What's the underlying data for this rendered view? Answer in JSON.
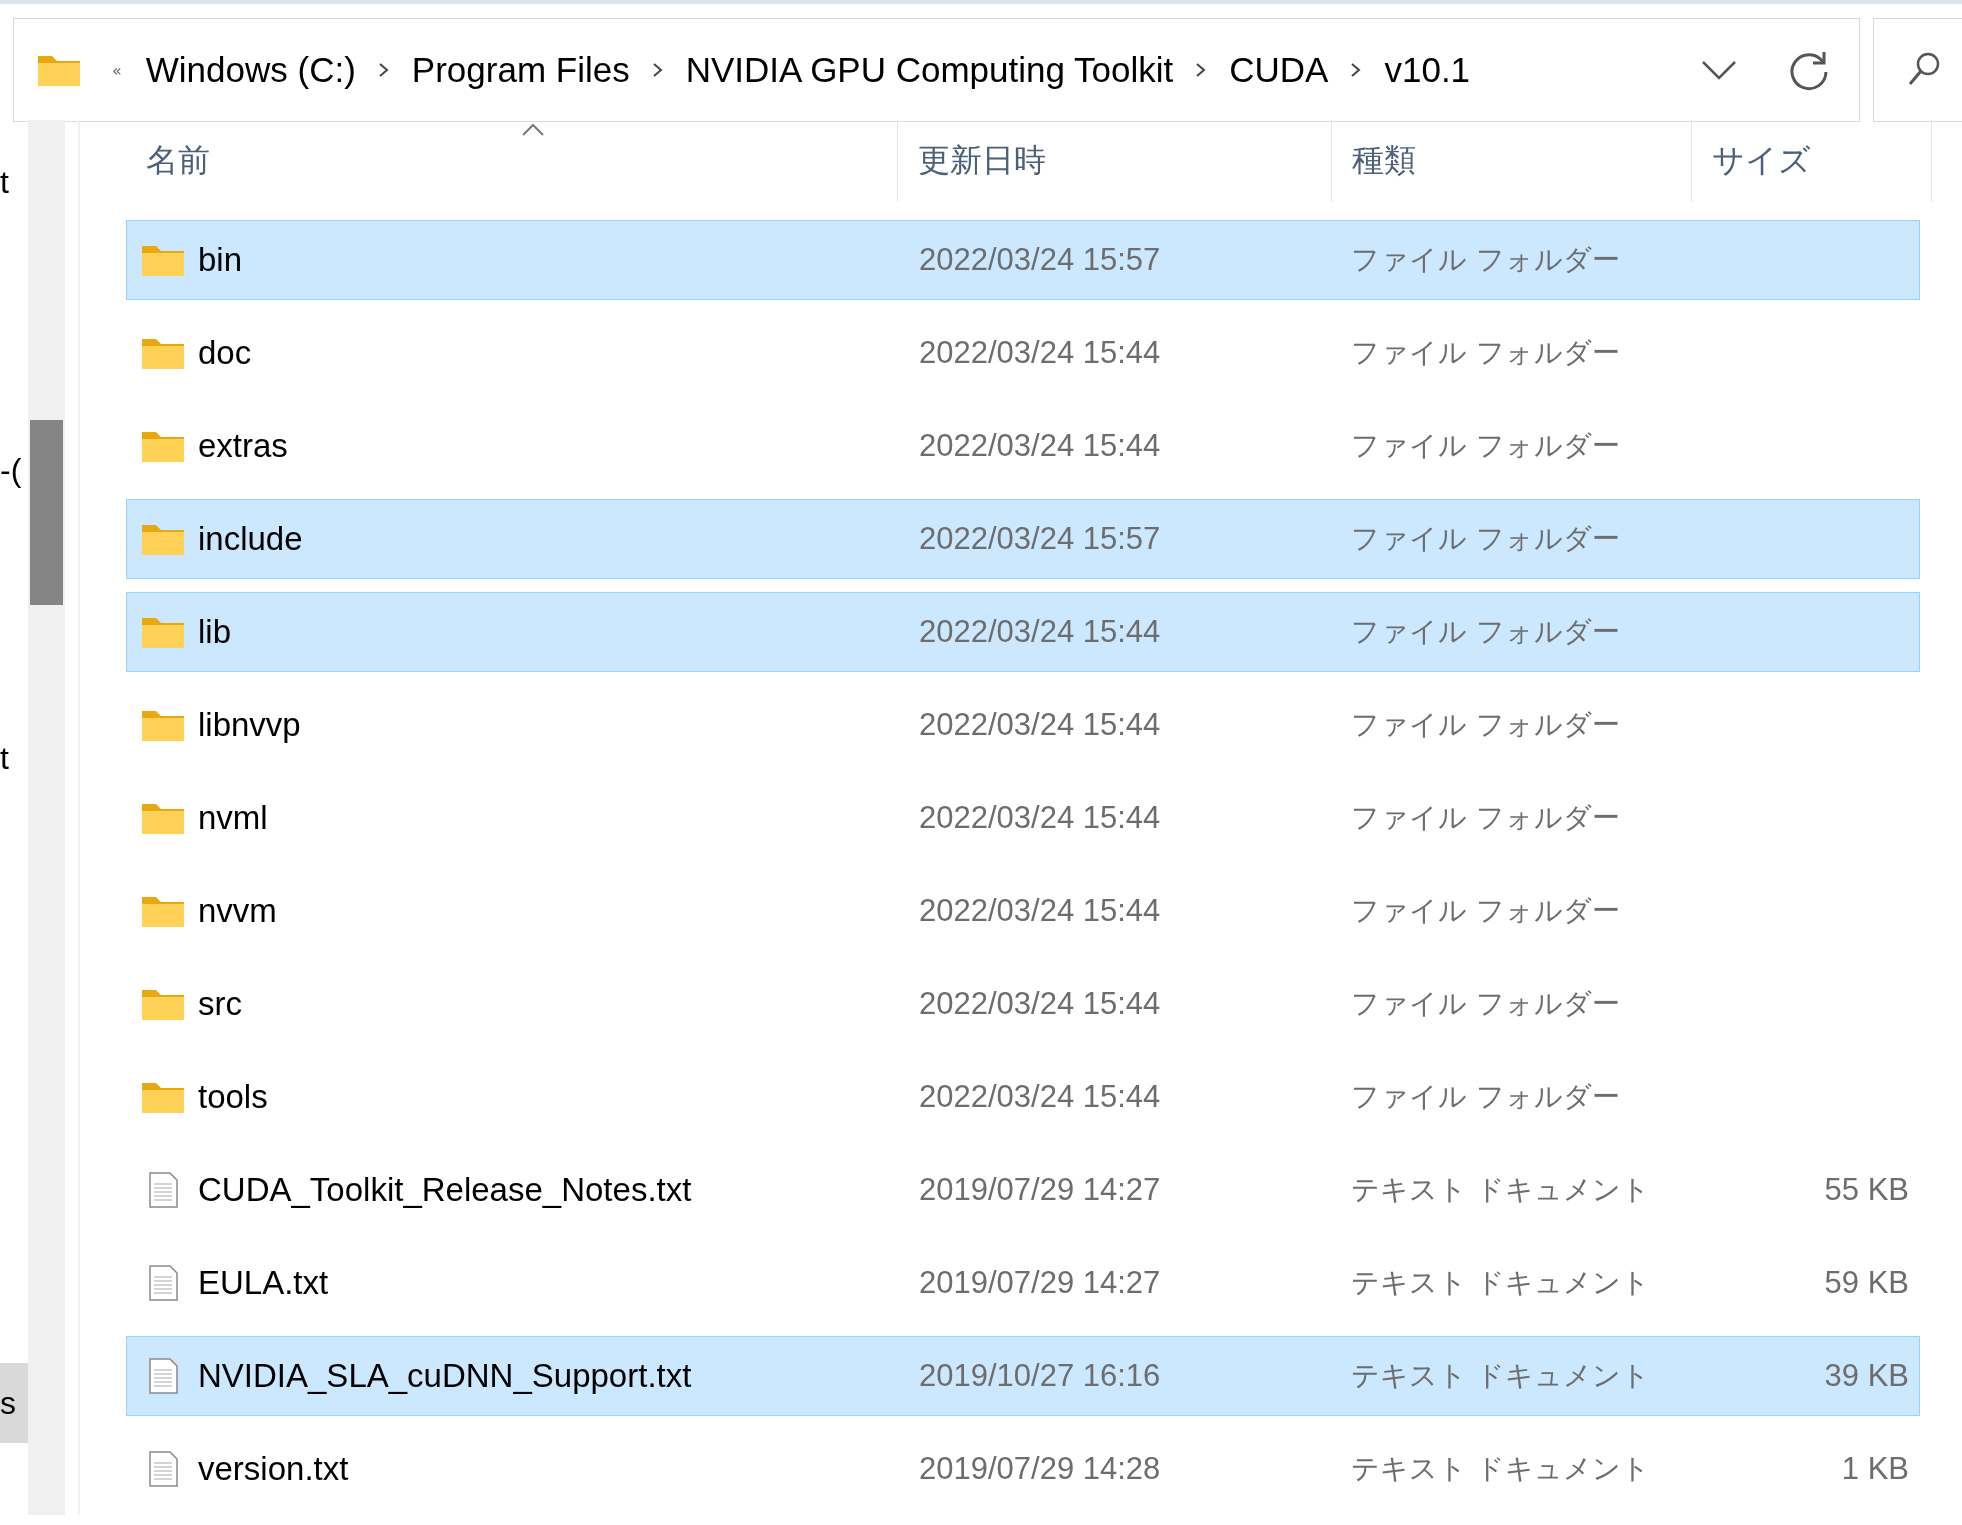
{
  "address_bar": {
    "overflow": "«",
    "crumbs": [
      "Windows (C:)",
      "Program Files",
      "NVIDIA GPU Computing Toolkit",
      "CUDA",
      "v10.1"
    ]
  },
  "nav_pane": {
    "items": [
      {
        "label": "t",
        "selected": false
      },
      {
        "label": "-(",
        "selected": false
      },
      {
        "label": "t",
        "selected": false
      },
      {
        "label": "s",
        "selected": true
      }
    ]
  },
  "table": {
    "columns": [
      "名前",
      "更新日時",
      "種類",
      "サイズ"
    ],
    "rows": [
      {
        "kind": "folder",
        "name": "bin",
        "modified": "2022/03/24 15:57",
        "type": "ファイル フォルダー",
        "selected": true
      },
      {
        "kind": "folder",
        "name": "doc",
        "modified": "2022/03/24 15:44",
        "type": "ファイル フォルダー",
        "selected": false
      },
      {
        "kind": "folder",
        "name": "extras",
        "modified": "2022/03/24 15:44",
        "type": "ファイル フォルダー",
        "selected": false
      },
      {
        "kind": "folder",
        "name": "include",
        "modified": "2022/03/24 15:57",
        "type": "ファイル フォルダー",
        "selected": true
      },
      {
        "kind": "folder",
        "name": "lib",
        "modified": "2022/03/24 15:44",
        "type": "ファイル フォルダー",
        "selected": true
      },
      {
        "kind": "folder",
        "name": "libnvvp",
        "modified": "2022/03/24 15:44",
        "type": "ファイル フォルダー",
        "selected": false
      },
      {
        "kind": "folder",
        "name": "nvml",
        "modified": "2022/03/24 15:44",
        "type": "ファイル フォルダー",
        "selected": false
      },
      {
        "kind": "folder",
        "name": "nvvm",
        "modified": "2022/03/24 15:44",
        "type": "ファイル フォルダー",
        "selected": false
      },
      {
        "kind": "folder",
        "name": "src",
        "modified": "2022/03/24 15:44",
        "type": "ファイル フォルダー",
        "selected": false
      },
      {
        "kind": "folder",
        "name": "tools",
        "modified": "2022/03/24 15:44",
        "type": "ファイル フォルダー",
        "selected": false
      },
      {
        "kind": "file",
        "name": "CUDA_Toolkit_Release_Notes.txt",
        "modified": "2019/07/29 14:27",
        "type": "テキスト ドキュメント",
        "size": "55 KB",
        "selected": false
      },
      {
        "kind": "file",
        "name": "EULA.txt",
        "modified": "2019/07/29 14:27",
        "type": "テキスト ドキュメント",
        "size": "59 KB",
        "selected": false
      },
      {
        "kind": "file",
        "name": "NVIDIA_SLA_cuDNN_Support.txt",
        "modified": "2019/10/27 16:16",
        "type": "テキスト ドキュメント",
        "size": "39 KB",
        "selected": true
      },
      {
        "kind": "file",
        "name": "version.txt",
        "modified": "2019/07/29 14:28",
        "type": "テキスト ドキュメント",
        "size": "1 KB",
        "selected": false
      }
    ]
  }
}
